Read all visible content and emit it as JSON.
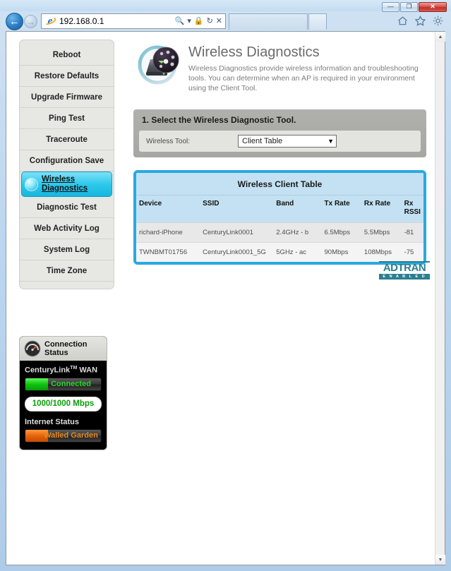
{
  "browser": {
    "url": "192.168.0.1",
    "window_controls": {
      "minimize": "—",
      "maximize": "❐",
      "close": "✕"
    },
    "address_icons": {
      "search": "search-icon",
      "dropdown": "▾",
      "lock": "lock-icon",
      "refresh": "↻",
      "stop": "✕"
    },
    "toolbar_icons": [
      "home-icon",
      "favorites-star-icon",
      "tools-gear-icon"
    ]
  },
  "sidebar": {
    "items": [
      {
        "label": "Reboot",
        "selected": false
      },
      {
        "label": "Restore Defaults",
        "selected": false
      },
      {
        "label": "Upgrade Firmware",
        "selected": false
      },
      {
        "label": "Ping Test",
        "selected": false
      },
      {
        "label": "Traceroute",
        "selected": false
      },
      {
        "label": "Configuration Save",
        "selected": false
      },
      {
        "label_line1": "Wireless",
        "label_line2": "Diagnostics",
        "selected": true
      },
      {
        "label": "Diagnostic Test",
        "selected": false
      },
      {
        "label": "Web Activity Log",
        "selected": false
      },
      {
        "label": "System Log",
        "selected": false
      },
      {
        "label": "Time Zone",
        "selected": false
      }
    ]
  },
  "connection_status": {
    "title_line1": "Connection",
    "title_line2": "Status",
    "wan_label": "CenturyLink",
    "wan_trademark": "TM",
    "wan_suffix": "WAN",
    "wan_state": "Connected",
    "wan_state_color": "#29d629",
    "speed": "1000/1000 Mbps",
    "speed_color": "#0a9d0a",
    "internet_label": "Internet Status",
    "internet_state": "Walled Garden",
    "internet_state_color": "#e8891e"
  },
  "header": {
    "title": "Wireless Diagnostics",
    "description": "Wireless Diagnostics provide wireless information and troubleshooting tools. You can determine when an AP is required in your environment using the Client Tool.",
    "icon": "wireless-diagnostics-icon"
  },
  "step": {
    "title": "1. Select the Wireless Diagnostic Tool.",
    "tool_label": "Wireless Tool:",
    "tool_value": "Client Table",
    "caret": "▼"
  },
  "client_table": {
    "caption": "Wireless Client Table",
    "columns": [
      "Device",
      "SSID",
      "Band",
      "Tx Rate",
      "Rx Rate",
      "Rx RSSI"
    ],
    "rssi_header_line1": "Rx",
    "rssi_header_line2": "RSSI",
    "rows": [
      {
        "device": "richard-iPhone",
        "ssid": "CenturyLink0001",
        "band": "2.4GHz - b",
        "tx_rate": "6.5Mbps",
        "rx_rate": "5.5Mbps",
        "rx_rssi": "-81"
      },
      {
        "device": "TWNBMT01756",
        "ssid": "CenturyLink0001_5G",
        "band": "5GHz - ac",
        "tx_rate": "90Mbps",
        "rx_rate": "108Mbps",
        "rx_rssi": "-75"
      }
    ]
  },
  "footer_logo": {
    "word": "ADTRAN",
    "sub": "E N A B L E D"
  },
  "colors": {
    "accent_blue": "#29a9e2",
    "table_header_blue": "#c3e1f2",
    "selected_menu": "#2ec9ec",
    "rssi_red": "#e8554a",
    "adtran_teal": "#2a7f8f"
  }
}
